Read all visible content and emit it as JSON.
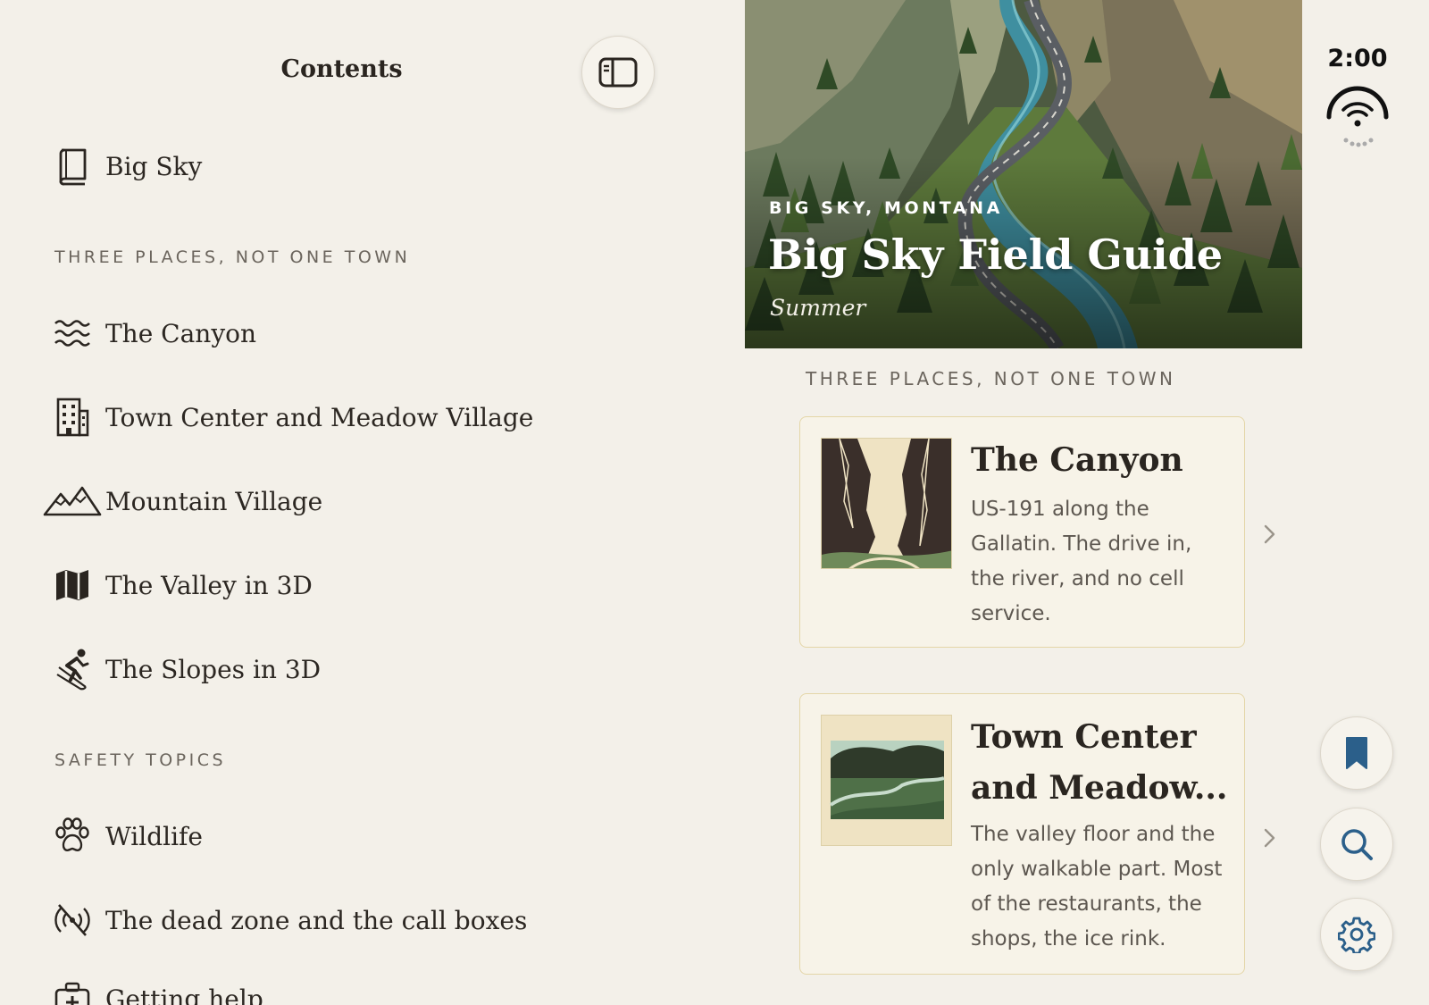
{
  "sidebar": {
    "title": "Contents",
    "toggle_icon": "sidebar-toggle-icon",
    "book_item": {
      "label": "Big Sky",
      "icon": "book-icon"
    },
    "section_places": "THREE PLACES, NOT ONE TOWN",
    "places": [
      {
        "label": "The Canyon",
        "icon": "waves-icon"
      },
      {
        "label": "Town Center and Meadow Village",
        "icon": "building-icon"
      },
      {
        "label": "Mountain Village",
        "icon": "mountains-icon"
      },
      {
        "label": "The Valley in 3D",
        "icon": "map-icon"
      },
      {
        "label": "The Slopes in 3D",
        "icon": "skier-icon"
      }
    ],
    "section_safety": "SAFETY TOPICS",
    "safety": [
      {
        "label": "Wildlife",
        "icon": "paw-icon"
      },
      {
        "label": "The dead zone and the call boxes",
        "icon": "no-signal-icon"
      },
      {
        "label": "Getting help",
        "icon": "medical-kit-icon"
      }
    ]
  },
  "hero": {
    "overline": "BIG SKY, MONTANA",
    "title": "Big Sky Field Guide",
    "subtitle": "Summer"
  },
  "main": {
    "section_header": "THREE PLACES, NOT ONE TOWN",
    "cards": [
      {
        "title": "The Canyon",
        "description": "US-191 along the Gallatin. The drive in, the river, and no cell service."
      },
      {
        "title_line1": "Town Center",
        "title_line2": "and Meadow...",
        "description": "The valley floor and the only walkable part. Most of the restaurants, the shops, the ice rink."
      }
    ]
  },
  "status": {
    "time": "2:00"
  },
  "colors": {
    "background": "#f3f0e9",
    "card_border": "#e4d6a8",
    "icon_blue": "#2b5f8a"
  }
}
